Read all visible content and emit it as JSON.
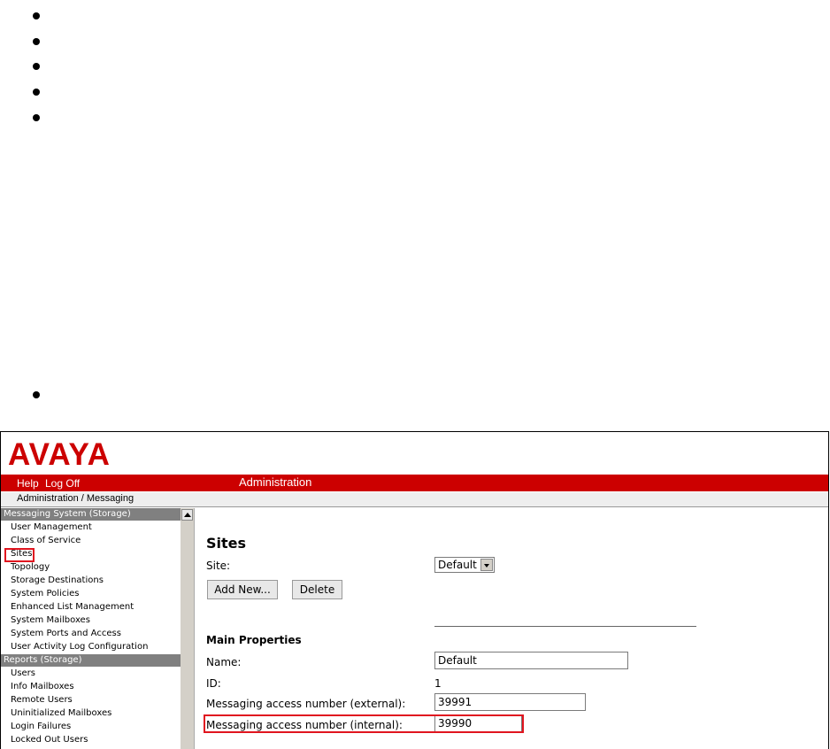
{
  "header": {
    "logo": "AVAYA",
    "help": "Help",
    "logoff": "Log Off",
    "title": "Administration",
    "breadcrumb": "Administration / Messaging"
  },
  "nav": {
    "section1": "Messaging System (Storage)",
    "items1": [
      "User Management",
      "Class of Service",
      "Sites",
      "Topology",
      "Storage Destinations",
      "System Policies",
      "Enhanced List Management",
      "System Mailboxes",
      "System Ports and Access",
      "User Activity Log Configuration"
    ],
    "section2": "Reports (Storage)",
    "items2": [
      "Users",
      "Info Mailboxes",
      "Remote Users",
      "Uninitialized Mailboxes",
      "Login Failures",
      "Locked Out Users"
    ]
  },
  "main": {
    "title": "Sites",
    "site_label": "Site:",
    "site_value": "Default",
    "add_new": "Add New...",
    "delete": "Delete",
    "section": "Main Properties",
    "name_label": "Name:",
    "name_value": "Default",
    "id_label": "ID:",
    "id_value": "1",
    "ext_label": "Messaging access number (external):",
    "ext_value": "39991",
    "int_label": "Messaging access number (internal):",
    "int_value": "39990"
  }
}
